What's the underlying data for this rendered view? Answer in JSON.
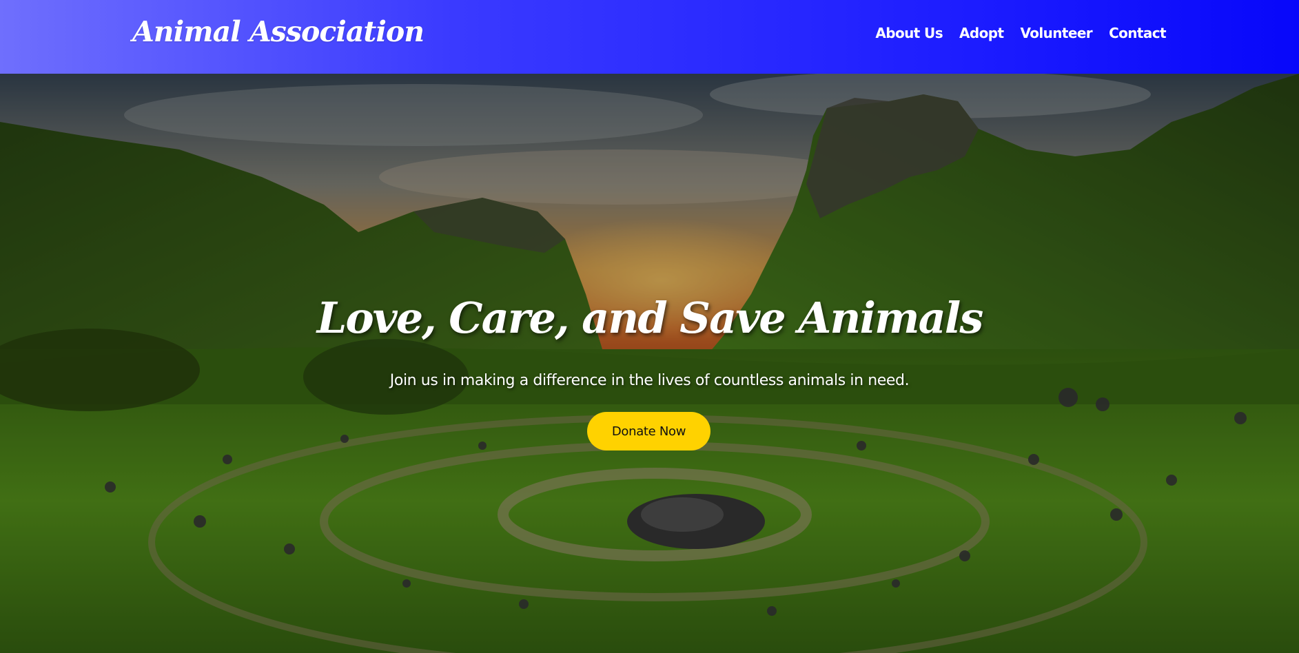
{
  "header": {
    "brand": "Animal Association",
    "nav": [
      {
        "label": "About Us"
      },
      {
        "label": "Adopt"
      },
      {
        "label": "Volunteer"
      },
      {
        "label": "Contact"
      }
    ]
  },
  "hero": {
    "title": "Love, Care, and Save Animals",
    "subtitle": "Join us in making a difference in the lives of countless animals in need.",
    "cta_label": "Donate Now",
    "background": "landscape-photo"
  },
  "colors": {
    "header_gradient_start": "#6f6ffd",
    "header_gradient_end": "#0707fa",
    "cta_background": "#ffd200",
    "text": "#ffffff"
  }
}
